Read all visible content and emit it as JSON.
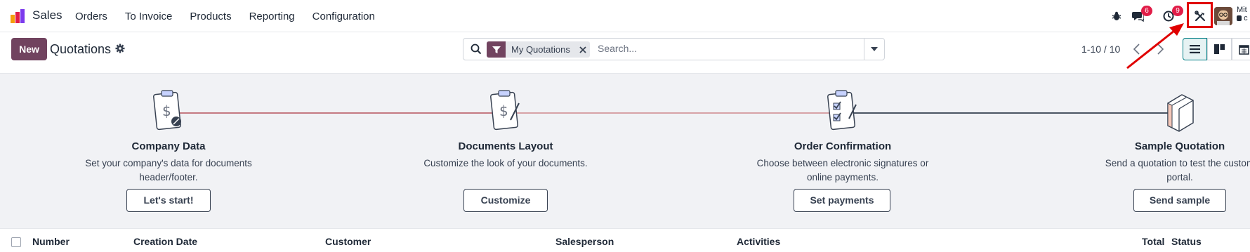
{
  "navbar": {
    "app_name": "Sales",
    "menu": [
      "Orders",
      "To Invoice",
      "Products",
      "Reporting",
      "Configuration"
    ],
    "messages_count": "6",
    "activities_count": "9",
    "user_name": "Mit",
    "user_company": "c"
  },
  "control_panel": {
    "new_label": "New",
    "title": "Quotations",
    "facet_label": "My Quotations",
    "search_placeholder": "Search...",
    "pager": "1-10 / 10"
  },
  "onboarding": [
    {
      "title": "Company Data",
      "desc": "Set your company's data for documents header/footer.",
      "button": "Let's start!"
    },
    {
      "title": "Documents Layout",
      "desc": "Customize the look of your documents.",
      "button": "Customize"
    },
    {
      "title": "Order Confirmation",
      "desc": "Choose between electronic signatures or online payments.",
      "button": "Set payments"
    },
    {
      "title": "Sample Quotation",
      "desc": "Send a quotation to test the custom portal.",
      "button": "Send sample"
    }
  ],
  "list_columns": [
    "Number",
    "Creation Date",
    "Customer",
    "Salesperson",
    "Activities",
    "Total",
    "Status"
  ],
  "colors": {
    "brand": "#71435f",
    "accent": "#017e84",
    "badge": "#e11d48",
    "highlight": "#e00000"
  }
}
